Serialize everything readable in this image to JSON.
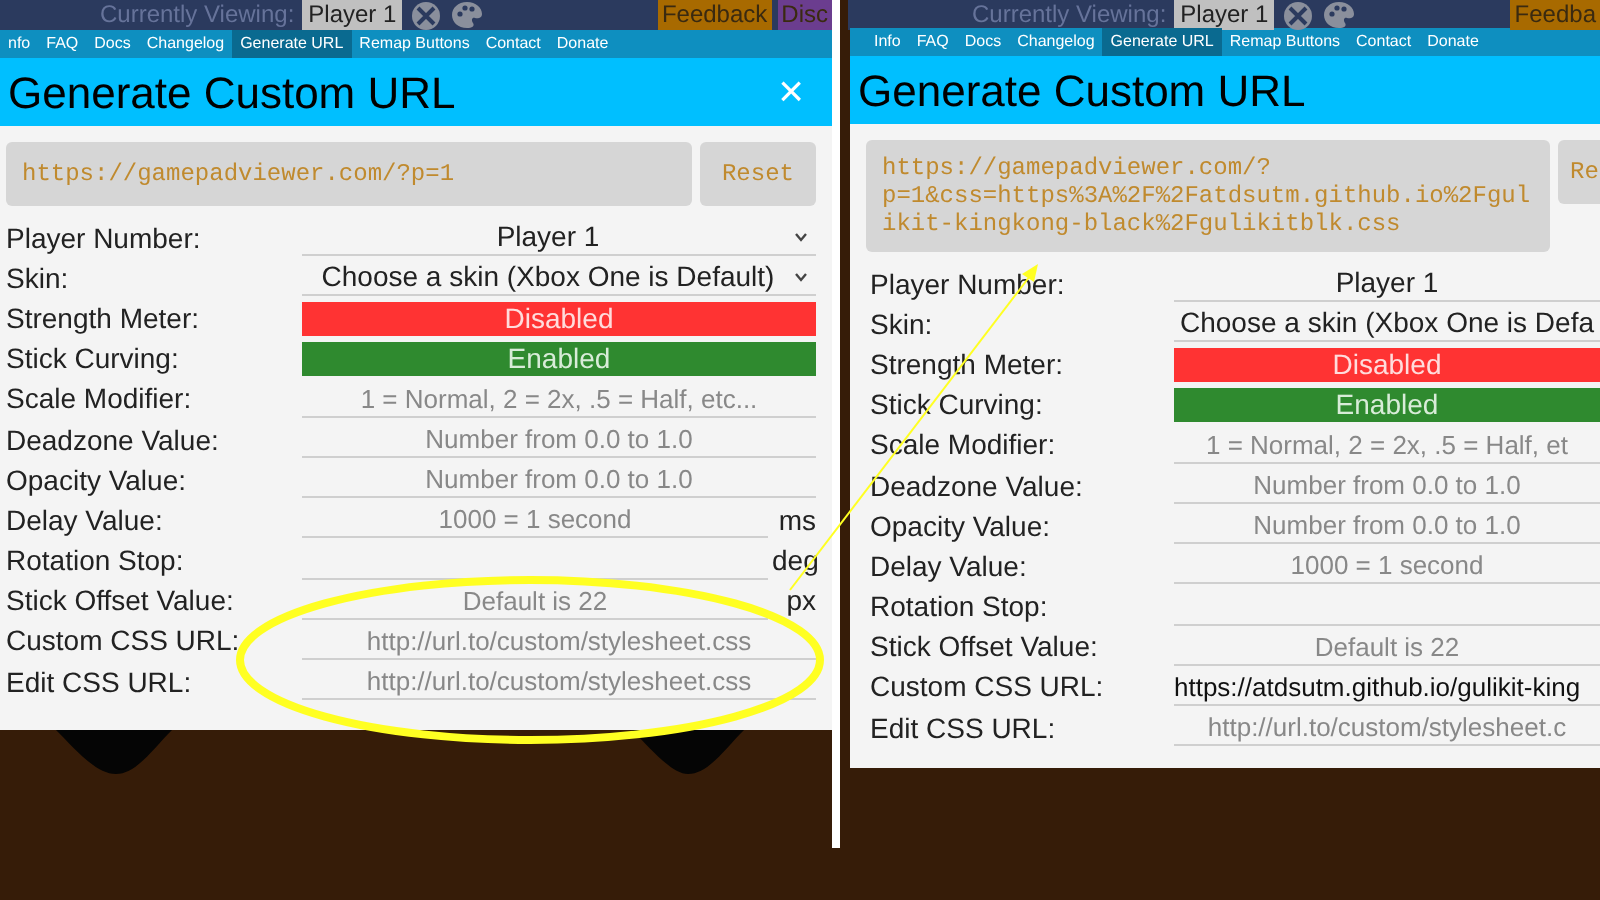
{
  "panels": [
    {
      "top_bar": {
        "label": "Currently Viewing:",
        "player": "Player 1",
        "buttons": [
          {
            "text": "Feedback",
            "color": "#a86a00"
          },
          {
            "text": "Disc",
            "color": "#6b3d8f"
          }
        ]
      },
      "tabs": [
        {
          "label": "nfo",
          "selected": false
        },
        {
          "label": "FAQ",
          "selected": false
        },
        {
          "label": "Docs",
          "selected": false
        },
        {
          "label": "Changelog",
          "selected": false
        },
        {
          "label": "Generate URL",
          "selected": true
        },
        {
          "label": "Remap Buttons",
          "selected": false
        },
        {
          "label": "Contact",
          "selected": false
        },
        {
          "label": "Donate",
          "selected": false
        }
      ],
      "dialog": {
        "title": "Generate Custom URL",
        "close": "×",
        "url": "https://gamepadviewer.com/?p=1",
        "reset": "Reset",
        "fields": [
          {
            "label": "Player Number:",
            "kind": "select",
            "value": "Player 1"
          },
          {
            "label": "Skin:",
            "kind": "select",
            "value": "Choose a skin (Xbox One is Default)"
          },
          {
            "label": "Strength Meter:",
            "kind": "toggle",
            "on": false,
            "value": "Disabled"
          },
          {
            "label": "Stick Curving:",
            "kind": "toggle",
            "on": true,
            "value": "Enabled"
          },
          {
            "label": "Scale Modifier:",
            "kind": "input",
            "placeholder": "1 = Normal, 2 = 2x, .5 = Half, etc..."
          },
          {
            "label": "Deadzone Value:",
            "kind": "input",
            "placeholder": "Number from 0.0 to 1.0"
          },
          {
            "label": "Opacity Value:",
            "kind": "input",
            "placeholder": "Number from 0.0 to 1.0"
          },
          {
            "label": "Delay Value:",
            "kind": "input",
            "placeholder": "1000 = 1 second",
            "unit": "ms"
          },
          {
            "label": "Rotation Stop:",
            "kind": "input",
            "unit": "deg"
          },
          {
            "label": "Stick Offset Value:",
            "kind": "input",
            "placeholder": "Default is 22",
            "unit": "px"
          },
          {
            "label": "Custom CSS URL:",
            "kind": "input",
            "placeholder": "http://url.to/custom/stylesheet.css"
          },
          {
            "label": "Edit CSS URL:",
            "kind": "input",
            "placeholder": "http://url.to/custom/stylesheet.css"
          }
        ]
      }
    },
    {
      "top_bar": {
        "label": "Currently Viewing:",
        "player": "Player 1",
        "buttons": [
          {
            "text": "Feedba",
            "color": "#a86a00"
          }
        ]
      },
      "tabs": [
        {
          "label": "Info",
          "selected": false
        },
        {
          "label": "FAQ",
          "selected": false
        },
        {
          "label": "Docs",
          "selected": false
        },
        {
          "label": "Changelog",
          "selected": false
        },
        {
          "label": "Generate URL",
          "selected": true
        },
        {
          "label": "Remap Buttons",
          "selected": false
        },
        {
          "label": "Contact",
          "selected": false
        },
        {
          "label": "Donate",
          "selected": false
        }
      ],
      "dialog": {
        "title": "Generate Custom URL",
        "url": "https://gamepadviewer.com/?p=1&css=https%3A%2F%2Fatdsutm.github.io%2Fgulikit-kingkong-black%2Fgulikitblk.css",
        "reset": "Re",
        "fields": [
          {
            "label": "Player Number:",
            "kind": "select",
            "value": "Player 1"
          },
          {
            "label": "Skin:",
            "kind": "select",
            "value": "Choose a skin (Xbox One is Defa"
          },
          {
            "label": "Strength Meter:",
            "kind": "toggle",
            "on": false,
            "value": "Disabled"
          },
          {
            "label": "Stick Curving:",
            "kind": "toggle",
            "on": true,
            "value": "Enabled"
          },
          {
            "label": "Scale Modifier:",
            "kind": "input",
            "placeholder": "1 = Normal, 2 = 2x, .5 = Half, et"
          },
          {
            "label": "Deadzone Value:",
            "kind": "input",
            "placeholder": "Number from 0.0 to 1.0"
          },
          {
            "label": "Opacity Value:",
            "kind": "input",
            "placeholder": "Number from 0.0 to 1.0"
          },
          {
            "label": "Delay Value:",
            "kind": "input",
            "placeholder": "1000 = 1 second"
          },
          {
            "label": "Rotation Stop:",
            "kind": "input"
          },
          {
            "label": "Stick Offset Value:",
            "kind": "input",
            "placeholder": "Default is 22"
          },
          {
            "label": "Custom CSS URL:",
            "kind": "input",
            "value": "https://atdsutm.github.io/gulikit-king"
          },
          {
            "label": "Edit CSS URL:",
            "kind": "input",
            "placeholder": "http://url.to/custom/stylesheet.c"
          }
        ]
      }
    }
  ]
}
